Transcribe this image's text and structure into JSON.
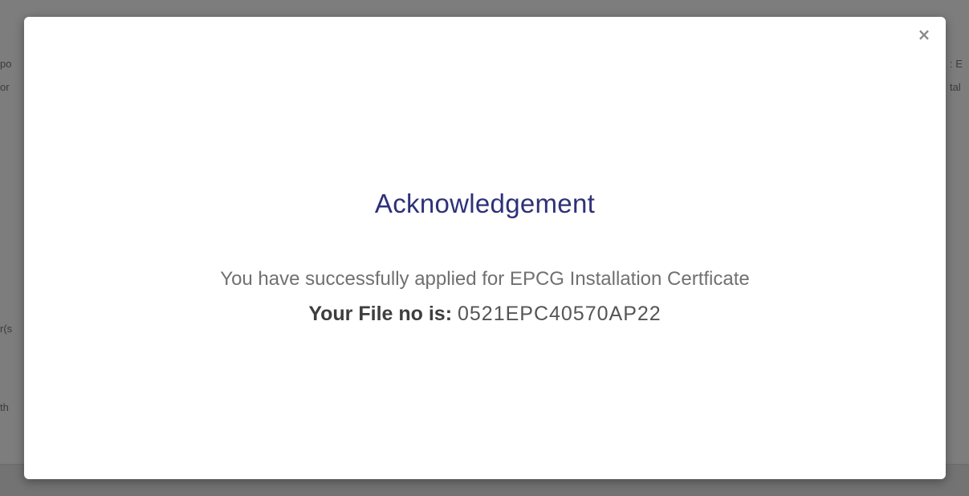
{
  "background": {
    "fragments": [
      "po",
      "or",
      "r(s",
      "th",
      ": E",
      "tal"
    ]
  },
  "modal": {
    "close_label": "×",
    "title": "Acknowledgement",
    "message": "You have successfully applied for EPCG Installation Certficate",
    "file_label": "Your File no is:",
    "file_value": "0521EPC40570AP22"
  },
  "colors": {
    "title": "#2e3178",
    "message": "#707070",
    "overlay": "#7d7d7d"
  }
}
